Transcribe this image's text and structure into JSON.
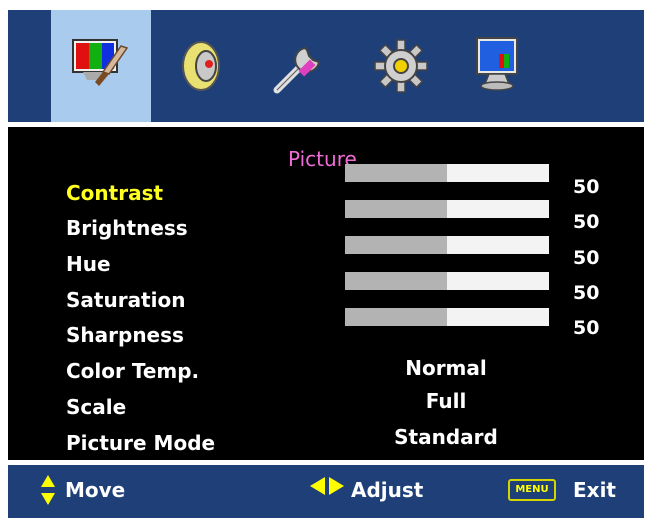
{
  "tabs": [
    {
      "icon": "picture-icon",
      "active": true
    },
    {
      "icon": "speaker-icon",
      "active": false
    },
    {
      "icon": "tools-icon",
      "active": false
    },
    {
      "icon": "gear-icon",
      "active": false
    },
    {
      "icon": "monitor-icon",
      "active": false
    }
  ],
  "panel": {
    "title": "Picture",
    "items": [
      {
        "label": "Contrast",
        "value": "50",
        "level": 0.5
      },
      {
        "label": "Brightness",
        "value": "50",
        "level": 0.5
      },
      {
        "label": "Hue",
        "value": "50",
        "level": 0.5
      },
      {
        "label": "Saturation",
        "value": "50",
        "level": 0.5
      },
      {
        "label": "Sharpness",
        "value": "50",
        "level": 0.5
      }
    ],
    "options": [
      {
        "label": "Color Temp.",
        "value": "Normal"
      },
      {
        "label": "Scale",
        "value": "Full"
      },
      {
        "label": "Picture Mode",
        "value": "Standard"
      }
    ]
  },
  "hints": {
    "move": "Move",
    "adjust": "Adjust",
    "menu_key": "MENU",
    "exit": "Exit"
  },
  "colors": {
    "bar_blue": "#1e3f78",
    "active_tab": "#a9cbee",
    "selected_text": "#ffff20",
    "title": "#f06bd6"
  }
}
